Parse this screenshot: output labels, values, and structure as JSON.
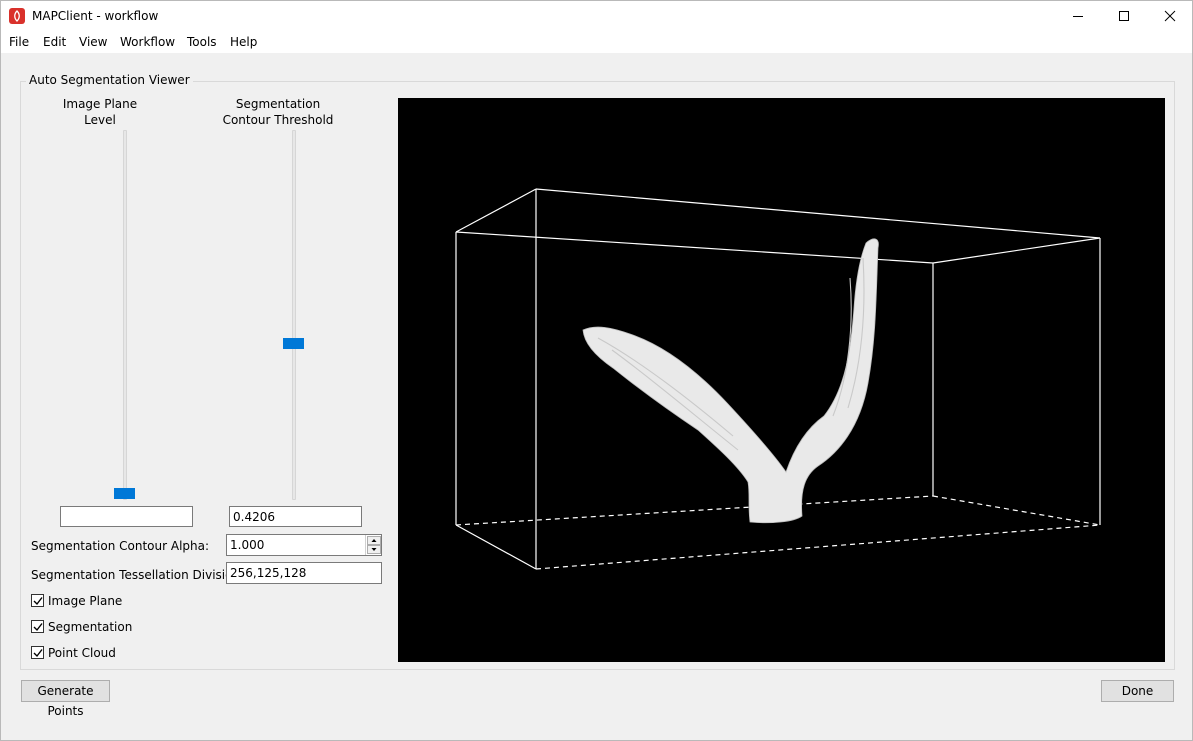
{
  "window": {
    "title": "MAPClient - workflow",
    "controls": [
      "minimize-icon",
      "maximize-icon",
      "close-icon"
    ],
    "brand_color": "#d9312b"
  },
  "menu": [
    "File",
    "Edit",
    "View",
    "Workflow",
    "Tools",
    "Help"
  ],
  "group": {
    "title": "Auto Segmentation Viewer"
  },
  "sliders": {
    "image_plane": {
      "label_line1": "Image Plane",
      "label_line2": "Level",
      "value_text": "",
      "level": 0.0
    },
    "segmentation": {
      "label_line1": "Segmentation",
      "label_line2": "Contour Threshold",
      "value_text": "0.4206",
      "level": 0.42
    }
  },
  "form": {
    "alpha_label": "Segmentation Contour Alpha:",
    "alpha_value": "1.000",
    "tess_label": "Segmentation Tessellation Divisions:",
    "tess_value": "256,125,128"
  },
  "checkboxes": [
    {
      "label": "Image Plane",
      "checked": true
    },
    {
      "label": "Segmentation",
      "checked": true
    },
    {
      "label": "Point Cloud",
      "checked": true
    }
  ],
  "viewer": {
    "background": "#000000",
    "line_color": "#ffffff",
    "surface_color": "#eeeeee"
  },
  "buttons": {
    "generate": "Generate Points",
    "done": "Done"
  },
  "colors": {
    "accent": "#0078d7"
  }
}
